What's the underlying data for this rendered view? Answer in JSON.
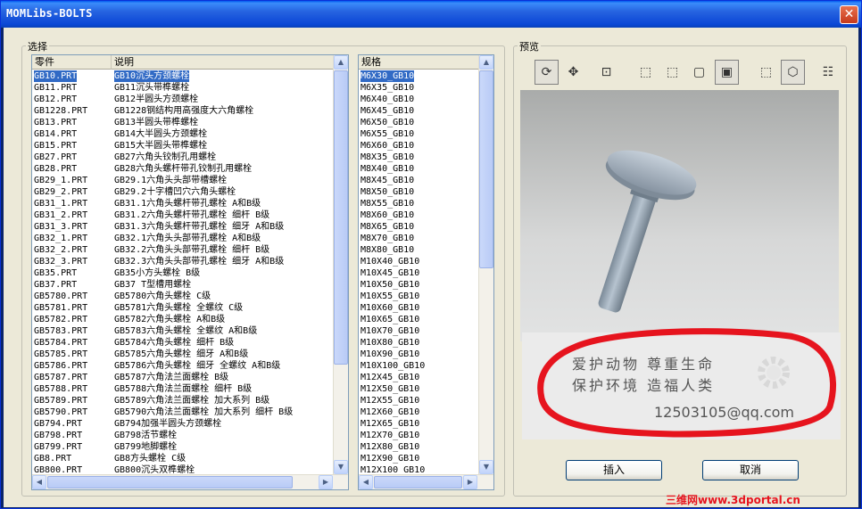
{
  "window": {
    "title": "MOMLibs-BOLTS",
    "close_glyph": "✕"
  },
  "select_group": {
    "label": "选择"
  },
  "preview_group": {
    "label": "预览"
  },
  "part_list": {
    "headers": {
      "part": "零件",
      "desc": "说明"
    },
    "rows": [
      {
        "part": "GB10.PRT",
        "desc": "GB10沉头方颈螺栓"
      },
      {
        "part": "GB11.PRT",
        "desc": "GB11沉头带榫螺栓"
      },
      {
        "part": "GB12.PRT",
        "desc": "GB12半圆头方颈螺栓"
      },
      {
        "part": "GB1228.PRT",
        "desc": "GB1228钢结构用高强度大六角螺栓"
      },
      {
        "part": "GB13.PRT",
        "desc": "GB13半圆头带榫螺栓"
      },
      {
        "part": "GB14.PRT",
        "desc": "GB14大半圆头方颈螺栓"
      },
      {
        "part": "GB15.PRT",
        "desc": "GB15大半圆头带榫螺栓"
      },
      {
        "part": "GB27.PRT",
        "desc": "GB27六角头铰制孔用螺栓"
      },
      {
        "part": "GB28.PRT",
        "desc": "GB28六角头螺杆带孔铰制孔用螺栓"
      },
      {
        "part": "GB29_1.PRT",
        "desc": "GB29.1六角头头部带槽螺栓"
      },
      {
        "part": "GB29_2.PRT",
        "desc": "GB29.2十字槽凹穴六角头螺栓"
      },
      {
        "part": "GB31_1.PRT",
        "desc": "GB31.1六角头螺杆带孔螺栓  A和B级"
      },
      {
        "part": "GB31_2.PRT",
        "desc": "GB31.2六角头螺杆带孔螺栓  细杆  B级"
      },
      {
        "part": "GB31_3.PRT",
        "desc": "GB31.3六角头螺杆带孔螺栓  细牙  A和B级"
      },
      {
        "part": "GB32_1.PRT",
        "desc": "GB32.1六角头头部带孔螺栓  A和B级"
      },
      {
        "part": "GB32_2.PRT",
        "desc": "GB32.2六角头头部带孔螺栓  细杆  B级"
      },
      {
        "part": "GB32_3.PRT",
        "desc": "GB32.3六角头头部带孔螺栓  细牙  A和B级"
      },
      {
        "part": "GB35.PRT",
        "desc": "GB35小方头螺栓  B级"
      },
      {
        "part": "GB37.PRT",
        "desc": "GB37 T型槽用螺栓"
      },
      {
        "part": "GB5780.PRT",
        "desc": "GB5780六角头螺栓  C级"
      },
      {
        "part": "GB5781.PRT",
        "desc": "GB5781六角头螺栓  全螺纹  C级"
      },
      {
        "part": "GB5782.PRT",
        "desc": "GB5782六角头螺栓  A和B级"
      },
      {
        "part": "GB5783.PRT",
        "desc": "GB5783六角头螺栓  全螺纹  A和B级"
      },
      {
        "part": "GB5784.PRT",
        "desc": "GB5784六角头螺栓  细杆  B级"
      },
      {
        "part": "GB5785.PRT",
        "desc": "GB5785六角头螺栓  细牙  A和B级"
      },
      {
        "part": "GB5786.PRT",
        "desc": "GB5786六角头螺栓  细牙  全螺纹  A和B级"
      },
      {
        "part": "GB5787.PRT",
        "desc": "GB5787六角法兰面螺栓  B级"
      },
      {
        "part": "GB5788.PRT",
        "desc": "GB5788六角法兰面螺栓  细杆  B级"
      },
      {
        "part": "GB5789.PRT",
        "desc": "GB5789六角法兰面螺栓  加大系列  B级"
      },
      {
        "part": "GB5790.PRT",
        "desc": "GB5790六角法兰面螺栓  加大系列  细杆  B级"
      },
      {
        "part": "GB794.PRT",
        "desc": "GB794加强半圆头方颈螺栓"
      },
      {
        "part": "GB798.PRT",
        "desc": "GB798活节螺栓"
      },
      {
        "part": "GB799.PRT",
        "desc": "GB799地脚螺栓"
      },
      {
        "part": "GB8.PRT",
        "desc": "GB8方头螺栓  C级"
      },
      {
        "part": "GB800.PRT",
        "desc": "GB800沉头双榫螺栓"
      }
    ]
  },
  "spec_list": {
    "header": "规格",
    "rows": [
      "M6X30_GB10",
      "M6X35_GB10",
      "M6X40_GB10",
      "M6X45_GB10",
      "M6X50_GB10",
      "M6X55_GB10",
      "M6X60_GB10",
      "M8X35_GB10",
      "M8X40_GB10",
      "M8X45_GB10",
      "M8X50_GB10",
      "M8X55_GB10",
      "M8X60_GB10",
      "M8X65_GB10",
      "M8X70_GB10",
      "M8X80_GB10",
      "M10X40_GB10",
      "M10X45_GB10",
      "M10X50_GB10",
      "M10X55_GB10",
      "M10X60_GB10",
      "M10X65_GB10",
      "M10X70_GB10",
      "M10X80_GB10",
      "M10X90_GB10",
      "M10X100_GB10",
      "M12X45_GB10",
      "M12X50_GB10",
      "M12X55_GB10",
      "M12X60_GB10",
      "M12X65_GB10",
      "M12X70_GB10",
      "M12X80_GB10",
      "M12X90_GB10",
      "M12X100 GB10"
    ]
  },
  "buttons": {
    "insert": "插入",
    "cancel": "取消"
  },
  "promo": {
    "line1": "爱护动物  尊重生命",
    "line2": "保护环境  造福人类",
    "email": "12503105@qq.com"
  },
  "watermark": "三维网www.3dportal.cn",
  "colors": {
    "selection": "#316ac5",
    "title_bar": "#0a47d6",
    "annotation_ring": "#e6141e"
  }
}
